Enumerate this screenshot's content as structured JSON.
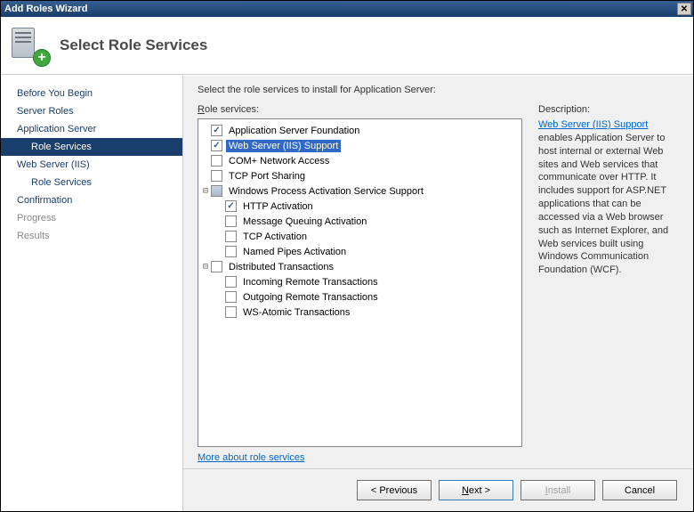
{
  "window": {
    "title": "Add Roles Wizard"
  },
  "header": {
    "title": "Select Role Services"
  },
  "nav": {
    "items": [
      {
        "label": "Before You Begin"
      },
      {
        "label": "Server Roles"
      },
      {
        "label": "Application Server"
      },
      {
        "label": "Role Services"
      },
      {
        "label": "Web Server (IIS)"
      },
      {
        "label": "Role Services"
      },
      {
        "label": "Confirmation"
      },
      {
        "label": "Progress"
      },
      {
        "label": "Results"
      }
    ]
  },
  "main": {
    "instruction": "Select the role services to install for Application Server:",
    "role_label_pre": "R",
    "role_label_post": "ole services:",
    "desc_label": "Description:",
    "more_link": "More about role services"
  },
  "tree": {
    "r0": "Application Server Foundation",
    "r1": "Web Server (IIS) Support",
    "r2": "COM+ Network Access",
    "r3": "TCP Port Sharing",
    "r4": "Windows Process Activation Service Support",
    "r5": "HTTP Activation",
    "r6": "Message Queuing Activation",
    "r7": "TCP Activation",
    "r8": "Named Pipes Activation",
    "r9": "Distributed Transactions",
    "r10": "Incoming Remote Transactions",
    "r11": "Outgoing Remote Transactions",
    "r12": "WS-Atomic Transactions"
  },
  "description": {
    "link": "Web Server (IIS) Support",
    "text": " enables Application Server to host internal or external Web sites and Web services that communicate over HTTP. It includes support for ASP.NET applications that can be accessed via a Web browser such as Internet Explorer, and Web services built using Windows Communication Foundation (WCF)."
  },
  "buttons": {
    "previous": "< Previous",
    "next": "Next >",
    "install": "Install",
    "cancel": "Cancel"
  }
}
